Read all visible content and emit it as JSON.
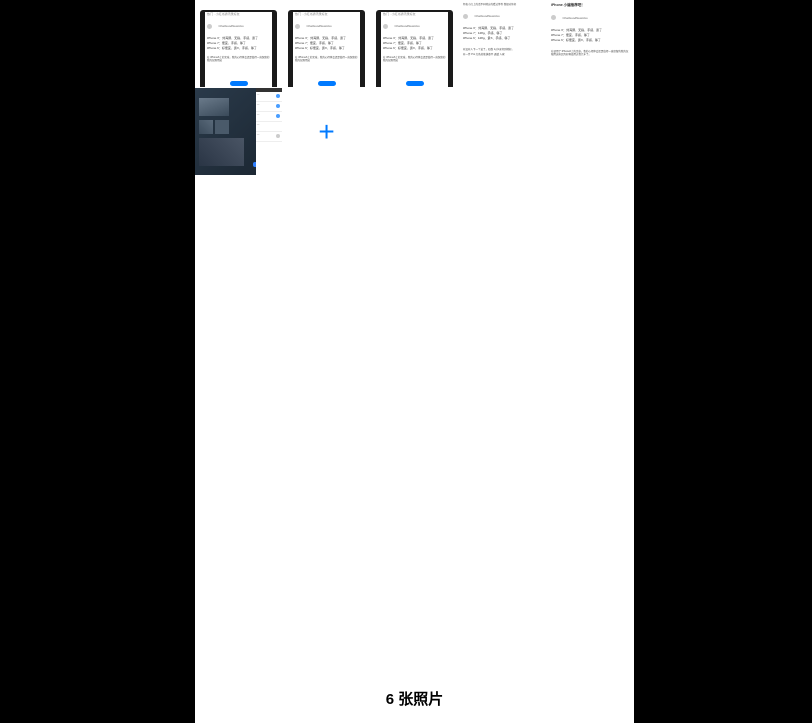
{
  "photoCount": "6 张照片",
  "addLabel": "+",
  "thumbs": [
    {
      "header": "热门 · 小红书通讯录好友",
      "user": "ChatGoodNewsGo",
      "line1": "iPhone X：刘海屏、无指、手感、贵了",
      "line2": "iPhone 7：便宜、手感、够了",
      "line3": "iPhone 6：好便宜、贵X、手感、够了",
      "para": "在 iPhone6上的文章，我的心得体会还是值得一直保留的我的仅限用这"
    },
    {
      "header": "热门 · 小红书通讯录好友",
      "user": "ChatGoodNewsGo",
      "line1": "iPhone X：刘海屏、无指、手感、贵了",
      "line2": "iPhone 7：便宜、手感、够了",
      "line3": "iPhone 6：好便宜、贵X、手感、够了",
      "para": "在 iPhone6上的文章，我的心得体会还是值得一直保留的我的仅限用这"
    },
    {
      "header": "热门 · 小红书通讯录好友",
      "user": "ChatGoodNewsGo",
      "line1": "iPhone X：刘海屏、无指、手感、贵了",
      "line2": "iPhone 7：便宜、手感、够了",
      "line3": "iPhone 6：好便宜、贵X、手感、够了",
      "para": "在 iPhone6上的文章，我的心得体会还是值得一直保留的我的仅限用这"
    },
    {
      "header": "特色小红上的话不同地方的看法等等 我想对你好",
      "user": "ChatGoodNewsGo",
      "line1": "iPhone X：刘海屏、无指、手感、贵了",
      "line2": "iPhone 7：128g、手感、够了",
      "line3": "iPhone 6：128g、贵X、手感、够了",
      "para1": "有没有人下一个说了，和我 1对1来特别地好。",
      "para2": "有一件 Pro     红色的能满意不 通透 人家"
    },
    {
      "title": "iPhone 小编推荐吧！",
      "user": "ChatGoodNewsGo",
      "line1": "iPhone X：刘海屏、无指、手感、贵了",
      "line2": "iPhone 7：便宜、手感、够了",
      "line3": "iPhone 6：好便宜、贵X、手感、够了",
      "para": "在使用了 iPhone6上的文章，我的心得体会还是值得一直保留的我的仅限用这些因为好像使用过程几年了。"
    },
    {
      "type": "dark"
    }
  ]
}
